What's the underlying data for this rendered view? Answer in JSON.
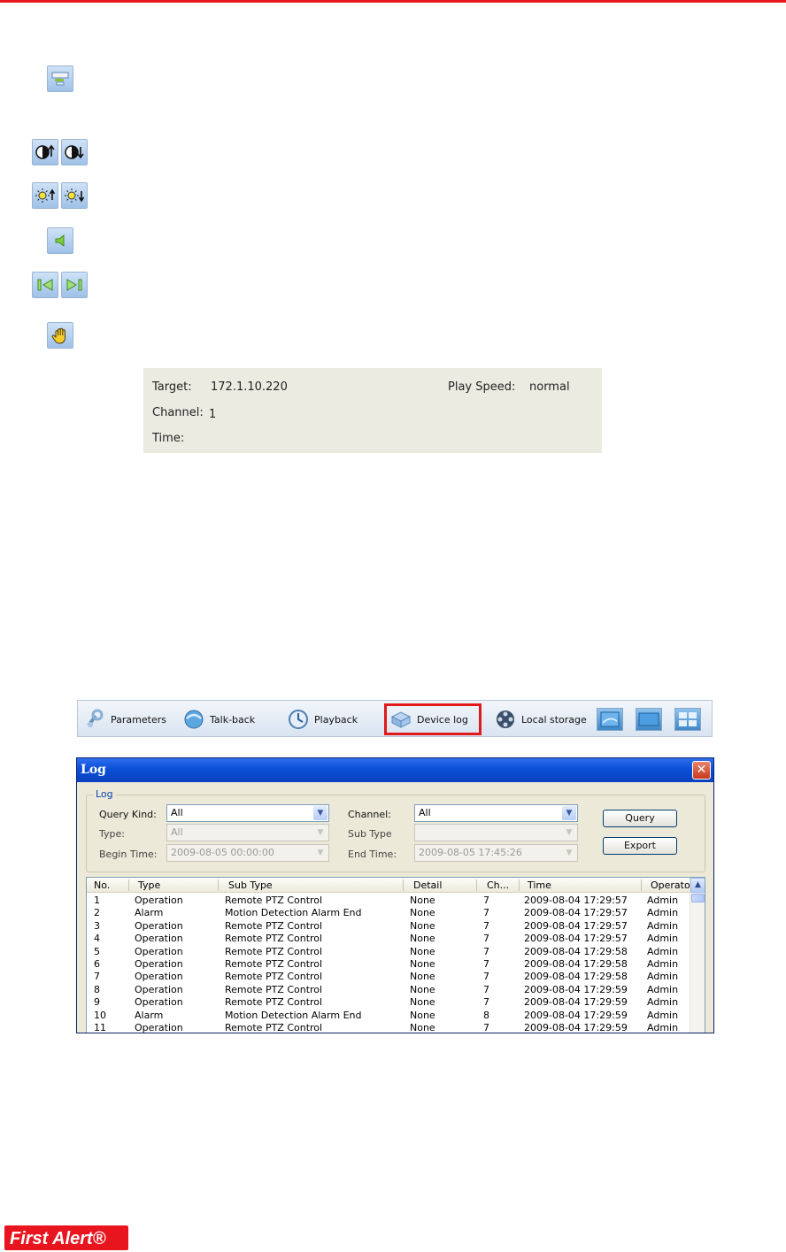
{
  "page": {
    "accent_color": "#e8141e"
  },
  "toolbar_icons": [
    {
      "name": "screen-icon"
    },
    {
      "name": "contrast-up-icon"
    },
    {
      "name": "contrast-down-icon"
    },
    {
      "name": "brightness-up-icon"
    },
    {
      "name": "brightness-down-icon"
    },
    {
      "name": "audio-icon"
    },
    {
      "name": "previous-icon"
    },
    {
      "name": "next-icon"
    },
    {
      "name": "hand-icon"
    }
  ],
  "status": {
    "target_label": "Target:",
    "target_value": "172.1.10.220",
    "play_speed_label": "Play Speed:",
    "play_speed_value": "normal",
    "channel_label": "Channel:",
    "channel_value": "1",
    "time_label": "Time:"
  },
  "main_toolbar": {
    "parameters": "Parameters",
    "talkback": "Talk-back",
    "playback": "Playback",
    "device_log": "Device log",
    "local_storage": "Local storage"
  },
  "log_window": {
    "title": "Log",
    "close_glyph": "✕",
    "group_title": "Log",
    "query_kind_label": "Query Kind:",
    "query_kind_value": "All",
    "channel_label": "Channel:",
    "channel_value": "All",
    "type_label": "Type:",
    "type_value": "All",
    "sub_type_label": "Sub Type",
    "sub_type_value": "",
    "begin_time_label": "Begin Time:",
    "begin_time_value": "2009-08-05 00:00:00",
    "end_time_label": "End Time:",
    "end_time_value": "2009-08-05 17:45:26",
    "query_button": "Query",
    "export_button": "Export",
    "columns": [
      "No.",
      "Type",
      "Sub Type",
      "Detail",
      "Ch...",
      "Time",
      "Operato"
    ],
    "rows": [
      [
        "1",
        "Operation",
        "Remote PTZ Control",
        "None",
        "7",
        "2009-08-04 17:29:57",
        "Admin"
      ],
      [
        "2",
        "Alarm",
        "Motion Detection Alarm End",
        "None",
        "7",
        "2009-08-04 17:29:57",
        "Admin"
      ],
      [
        "3",
        "Operation",
        "Remote PTZ Control",
        "None",
        "7",
        "2009-08-04 17:29:57",
        "Admin"
      ],
      [
        "4",
        "Operation",
        "Remote PTZ Control",
        "None",
        "7",
        "2009-08-04 17:29:57",
        "Admin"
      ],
      [
        "5",
        "Operation",
        "Remote PTZ Control",
        "None",
        "7",
        "2009-08-04 17:29:58",
        "Admin"
      ],
      [
        "6",
        "Operation",
        "Remote PTZ Control",
        "None",
        "7",
        "2009-08-04 17:29:58",
        "Admin"
      ],
      [
        "7",
        "Operation",
        "Remote PTZ Control",
        "None",
        "7",
        "2009-08-04 17:29:58",
        "Admin"
      ],
      [
        "8",
        "Operation",
        "Remote PTZ Control",
        "None",
        "7",
        "2009-08-04 17:29:59",
        "Admin"
      ],
      [
        "9",
        "Operation",
        "Remote PTZ Control",
        "None",
        "7",
        "2009-08-04 17:29:59",
        "Admin"
      ],
      [
        "10",
        "Alarm",
        "Motion Detection Alarm End",
        "None",
        "8",
        "2009-08-04 17:29:59",
        "Admin"
      ],
      [
        "11",
        "Operation",
        "Remote PTZ Control",
        "None",
        "7",
        "2009-08-04 17:29:59",
        "Admin"
      ]
    ]
  },
  "brand": {
    "text": "First Alert®",
    "color": "#e8141e"
  }
}
